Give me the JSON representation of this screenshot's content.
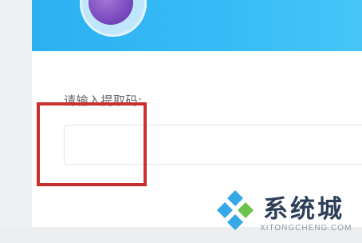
{
  "extract_form": {
    "label": "请输入提取码:",
    "input_value": "",
    "input_placeholder": ""
  },
  "watermark": {
    "brand": "系统城",
    "url": "XITONGCHENG.COM",
    "logo_icon": "diamond-logo-icon"
  },
  "colors": {
    "banner": "#37bdf6",
    "highlight": "#c8302f"
  }
}
